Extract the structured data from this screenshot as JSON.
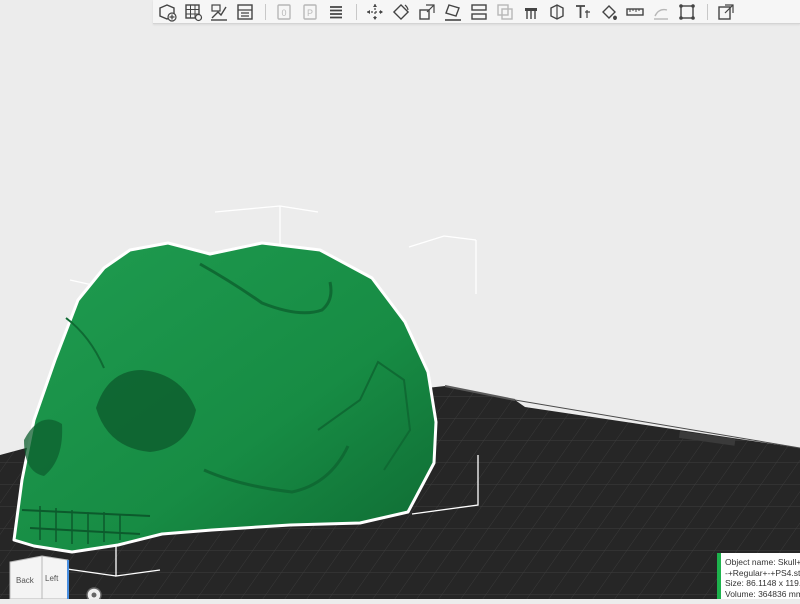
{
  "toolbar": {
    "tools": [
      {
        "name": "add-object-icon",
        "active": true
      },
      {
        "name": "arrange-grid-icon",
        "active": true
      },
      {
        "name": "orient-icon",
        "active": true
      },
      {
        "name": "layout-icon",
        "active": true
      },
      {
        "name": "plate-zero-icon",
        "active": false
      },
      {
        "name": "plate-p-icon",
        "active": false
      },
      {
        "name": "layers-icon",
        "active": true
      },
      {
        "name": "move-icon",
        "active": true
      },
      {
        "name": "rotate-icon",
        "active": true
      },
      {
        "name": "scale-icon",
        "active": true
      },
      {
        "name": "lay-on-face-icon",
        "active": true
      },
      {
        "name": "cut-icon",
        "active": true
      },
      {
        "name": "boolean-icon",
        "active": false
      },
      {
        "name": "support-paint-icon",
        "active": true
      },
      {
        "name": "seam-paint-icon",
        "active": true
      },
      {
        "name": "text-emboss-icon",
        "active": true
      },
      {
        "name": "color-paint-icon",
        "active": true
      },
      {
        "name": "measure-icon",
        "active": true
      },
      {
        "name": "assembly-icon",
        "active": false
      },
      {
        "name": "variable-height-icon",
        "active": true
      },
      {
        "name": "slice-preview-icon",
        "active": true
      }
    ]
  },
  "view_cube": {
    "face_back": "Back",
    "face_left": "Left"
  },
  "object_info": {
    "name_line": "Object name: Skull+",
    "profile_line": "-+Regular+-+PS4.st",
    "size_line": "Size: 86.1148 x 119.",
    "volume_line": "Volume: 364836 mm"
  },
  "colors": {
    "background": "#ececec",
    "bed": "#262626",
    "grid": "#3a3a3a",
    "model": "#199048",
    "model_dark": "#0f6a33",
    "selection_outline": "#ffffff",
    "accent": "#1db24c"
  }
}
